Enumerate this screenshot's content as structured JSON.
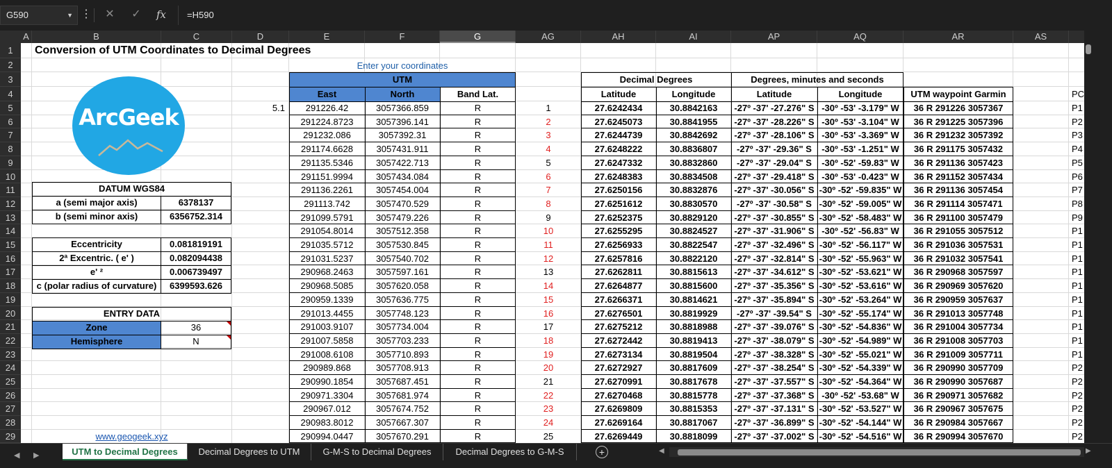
{
  "formula_bar": {
    "name_box": "G590",
    "cancel_icon": "✕",
    "enter_icon": "✓",
    "function_icon": "fx",
    "formula": "=H590"
  },
  "columns": [
    "A",
    "B",
    "C",
    "D",
    "E",
    "F",
    "G",
    "AG",
    "AH",
    "AI",
    "AP",
    "AQ",
    "AR",
    "AS"
  ],
  "selected_column": "G",
  "rows": [
    "1",
    "2",
    "3",
    "4",
    "5",
    "6",
    "7",
    "8",
    "9",
    "10",
    "11",
    "12",
    "13",
    "14",
    "15",
    "16",
    "17",
    "18",
    "19",
    "20",
    "21",
    "22",
    "23",
    "24",
    "25",
    "26",
    "27",
    "28",
    "29"
  ],
  "sheet": {
    "title": "Conversion of UTM Coordinates to Decimal Degrees",
    "hint": "Enter your coordinates",
    "logo_text": "ArcGeek",
    "d5_value": "5.1",
    "datum": {
      "title": "DATUM WGS84",
      "rows": [
        {
          "label": "a (semi major axis)",
          "value": "6378137"
        },
        {
          "label": "b (semi minor axis)",
          "value": "6356752.314"
        }
      ]
    },
    "ecc": {
      "rows": [
        {
          "label": "Eccentricity",
          "value": "0.081819191"
        },
        {
          "label": "2ª Excentric. ( e' )",
          "value": "0.082094438"
        },
        {
          "label": "e' ²",
          "value": "0.006739497"
        },
        {
          "label": "c (polar radius of curvature)",
          "value": "6399593.626"
        }
      ]
    },
    "entry": {
      "title": "ENTRY DATA",
      "zone_label": "Zone",
      "zone_value": "36",
      "hemisphere_label": "Hemisphere",
      "hemisphere_value": "N"
    },
    "link": "www.geogeek.xyz",
    "utm_header": "UTM",
    "east_header": "East",
    "north_header": "North",
    "band_header": "Band Lat.",
    "dd_header": "Decimal Degrees",
    "dms_header": "Degrees, minutes and seconds",
    "lat_header": "Latitude",
    "lon_header": "Longitude",
    "garmin_header": "UTM waypoint Garmin",
    "as_header": "PC",
    "data_rows": [
      {
        "east": "291226.42",
        "north": "3057366.859",
        "band": "R",
        "ag": "1",
        "ag_red": false,
        "lat": "27.6242434",
        "lon": "30.8842163",
        "lat_dms": "-27º -37' -27.276\" S",
        "lon_dms": "-30º -53' -3.179\" W",
        "garmin": "36 R 291226 3057367",
        "as": "P1"
      },
      {
        "east": "291224.8723",
        "north": "3057396.141",
        "band": "R",
        "ag": "2",
        "ag_red": true,
        "lat": "27.6245073",
        "lon": "30.8841955",
        "lat_dms": "-27º -37' -28.226\" S",
        "lon_dms": "-30º -53' -3.104\" W",
        "garmin": "36 R 291225 3057396",
        "as": "P2"
      },
      {
        "east": "291232.086",
        "north": "3057392.31",
        "band": "R",
        "ag": "3",
        "ag_red": true,
        "lat": "27.6244739",
        "lon": "30.8842692",
        "lat_dms": "-27º -37' -28.106\" S",
        "lon_dms": "-30º -53' -3.369\" W",
        "garmin": "36 R 291232 3057392",
        "as": "P3"
      },
      {
        "east": "291174.6628",
        "north": "3057431.911",
        "band": "R",
        "ag": "4",
        "ag_red": true,
        "lat": "27.6248222",
        "lon": "30.8836807",
        "lat_dms": "-27º -37' -29.36\" S",
        "lon_dms": "-30º -53' -1.251\" W",
        "garmin": "36 R 291175 3057432",
        "as": "P4"
      },
      {
        "east": "291135.5346",
        "north": "3057422.713",
        "band": "R",
        "ag": "5",
        "ag_red": false,
        "lat": "27.6247332",
        "lon": "30.8832860",
        "lat_dms": "-27º -37' -29.04\" S",
        "lon_dms": "-30º -52' -59.83\" W",
        "garmin": "36 R 291136 3057423",
        "as": "P5"
      },
      {
        "east": "291151.9994",
        "north": "3057434.084",
        "band": "R",
        "ag": "6",
        "ag_red": true,
        "lat": "27.6248383",
        "lon": "30.8834508",
        "lat_dms": "-27º -37' -29.418\" S",
        "lon_dms": "-30º -53' -0.423\" W",
        "garmin": "36 R 291152 3057434",
        "as": "P6"
      },
      {
        "east": "291136.2261",
        "north": "3057454.004",
        "band": "R",
        "ag": "7",
        "ag_red": true,
        "lat": "27.6250156",
        "lon": "30.8832876",
        "lat_dms": "-27º -37' -30.056\" S",
        "lon_dms": "-30º -52' -59.835\" W",
        "garmin": "36 R 291136 3057454",
        "as": "P7"
      },
      {
        "east": "291113.742",
        "north": "3057470.529",
        "band": "R",
        "ag": "8",
        "ag_red": true,
        "lat": "27.6251612",
        "lon": "30.8830570",
        "lat_dms": "-27º -37' -30.58\" S",
        "lon_dms": "-30º -52' -59.005\" W",
        "garmin": "36 R 291114 3057471",
        "as": "P8"
      },
      {
        "east": "291099.5791",
        "north": "3057479.226",
        "band": "R",
        "ag": "9",
        "ag_red": false,
        "lat": "27.6252375",
        "lon": "30.8829120",
        "lat_dms": "-27º -37' -30.855\" S",
        "lon_dms": "-30º -52' -58.483\" W",
        "garmin": "36 R 291100 3057479",
        "as": "P9"
      },
      {
        "east": "291054.8014",
        "north": "3057512.358",
        "band": "R",
        "ag": "10",
        "ag_red": true,
        "lat": "27.6255295",
        "lon": "30.8824527",
        "lat_dms": "-27º -37' -31.906\" S",
        "lon_dms": "-30º -52' -56.83\" W",
        "garmin": "36 R 291055 3057512",
        "as": "P1"
      },
      {
        "east": "291035.5712",
        "north": "3057530.845",
        "band": "R",
        "ag": "11",
        "ag_red": true,
        "lat": "27.6256933",
        "lon": "30.8822547",
        "lat_dms": "-27º -37' -32.496\" S",
        "lon_dms": "-30º -52' -56.117\" W",
        "garmin": "36 R 291036 3057531",
        "as": "P1"
      },
      {
        "east": "291031.5237",
        "north": "3057540.702",
        "band": "R",
        "ag": "12",
        "ag_red": true,
        "lat": "27.6257816",
        "lon": "30.8822120",
        "lat_dms": "-27º -37' -32.814\" S",
        "lon_dms": "-30º -52' -55.963\" W",
        "garmin": "36 R 291032 3057541",
        "as": "P1"
      },
      {
        "east": "290968.2463",
        "north": "3057597.161",
        "band": "R",
        "ag": "13",
        "ag_red": false,
        "lat": "27.6262811",
        "lon": "30.8815613",
        "lat_dms": "-27º -37' -34.612\" S",
        "lon_dms": "-30º -52' -53.621\" W",
        "garmin": "36 R 290968 3057597",
        "as": "P1"
      },
      {
        "east": "290968.5085",
        "north": "3057620.058",
        "band": "R",
        "ag": "14",
        "ag_red": true,
        "lat": "27.6264877",
        "lon": "30.8815600",
        "lat_dms": "-27º -37' -35.356\" S",
        "lon_dms": "-30º -52' -53.616\" W",
        "garmin": "36 R 290969 3057620",
        "as": "P1"
      },
      {
        "east": "290959.1339",
        "north": "3057636.775",
        "band": "R",
        "ag": "15",
        "ag_red": true,
        "lat": "27.6266371",
        "lon": "30.8814621",
        "lat_dms": "-27º -37' -35.894\" S",
        "lon_dms": "-30º -52' -53.264\" W",
        "garmin": "36 R 290959 3057637",
        "as": "P1"
      },
      {
        "east": "291013.4455",
        "north": "3057748.123",
        "band": "R",
        "ag": "16",
        "ag_red": true,
        "lat": "27.6276501",
        "lon": "30.8819929",
        "lat_dms": "-27º -37' -39.54\" S",
        "lon_dms": "-30º -52' -55.174\" W",
        "garmin": "36 R 291013 3057748",
        "as": "P1"
      },
      {
        "east": "291003.9107",
        "north": "3057734.004",
        "band": "R",
        "ag": "17",
        "ag_red": false,
        "lat": "27.6275212",
        "lon": "30.8818988",
        "lat_dms": "-27º -37' -39.076\" S",
        "lon_dms": "-30º -52' -54.836\" W",
        "garmin": "36 R 291004 3057734",
        "as": "P1"
      },
      {
        "east": "291007.5858",
        "north": "3057703.233",
        "band": "R",
        "ag": "18",
        "ag_red": true,
        "lat": "27.6272442",
        "lon": "30.8819413",
        "lat_dms": "-27º -37' -38.079\" S",
        "lon_dms": "-30º -52' -54.989\" W",
        "garmin": "36 R 291008 3057703",
        "as": "P1"
      },
      {
        "east": "291008.6108",
        "north": "3057710.893",
        "band": "R",
        "ag": "19",
        "ag_red": true,
        "lat": "27.6273134",
        "lon": "30.8819504",
        "lat_dms": "-27º -37' -38.328\" S",
        "lon_dms": "-30º -52' -55.021\" W",
        "garmin": "36 R 291009 3057711",
        "as": "P1"
      },
      {
        "east": "290989.868",
        "north": "3057708.913",
        "band": "R",
        "ag": "20",
        "ag_red": true,
        "lat": "27.6272927",
        "lon": "30.8817609",
        "lat_dms": "-27º -37' -38.254\" S",
        "lon_dms": "-30º -52' -54.339\" W",
        "garmin": "36 R 290990 3057709",
        "as": "P2"
      },
      {
        "east": "290990.1854",
        "north": "3057687.451",
        "band": "R",
        "ag": "21",
        "ag_red": false,
        "lat": "27.6270991",
        "lon": "30.8817678",
        "lat_dms": "-27º -37' -37.557\" S",
        "lon_dms": "-30º -52' -54.364\" W",
        "garmin": "36 R 290990 3057687",
        "as": "P2"
      },
      {
        "east": "290971.3304",
        "north": "3057681.974",
        "band": "R",
        "ag": "22",
        "ag_red": true,
        "lat": "27.6270468",
        "lon": "30.8815778",
        "lat_dms": "-27º -37' -37.368\" S",
        "lon_dms": "-30º -52' -53.68\" W",
        "garmin": "36 R 290971 3057682",
        "as": "P2"
      },
      {
        "east": "290967.012",
        "north": "3057674.752",
        "band": "R",
        "ag": "23",
        "ag_red": true,
        "lat": "27.6269809",
        "lon": "30.8815353",
        "lat_dms": "-27º -37' -37.131\" S",
        "lon_dms": "-30º -52' -53.527\" W",
        "garmin": "36 R 290967 3057675",
        "as": "P2"
      },
      {
        "east": "290983.8012",
        "north": "3057667.307",
        "band": "R",
        "ag": "24",
        "ag_red": true,
        "lat": "27.6269164",
        "lon": "30.8817067",
        "lat_dms": "-27º -37' -36.899\" S",
        "lon_dms": "-30º -52' -54.144\" W",
        "garmin": "36 R 290984 3057667",
        "as": "P2"
      },
      {
        "east": "290994.0447",
        "north": "3057670.291",
        "band": "R",
        "ag": "25",
        "ag_red": false,
        "lat": "27.6269449",
        "lon": "30.8818099",
        "lat_dms": "-27º -37' -37.002\" S",
        "lon_dms": "-30º -52' -54.516\" W",
        "garmin": "36 R 290994 3057670",
        "as": "P2"
      }
    ]
  },
  "tabs": [
    {
      "label": "UTM to Decimal Degrees",
      "active": true
    },
    {
      "label": "Decimal Degrees to UTM",
      "active": false
    },
    {
      "label": "G-M-S to Decimal Degrees",
      "active": false
    },
    {
      "label": "Decimal Degrees to G-M-S",
      "active": false
    }
  ],
  "add_sheet_icon": "+",
  "colors": {
    "accent_blue": "#4f86d0",
    "red": "#e02020",
    "tab_green": "#217346",
    "logo_blue": "#21a7e4"
  }
}
